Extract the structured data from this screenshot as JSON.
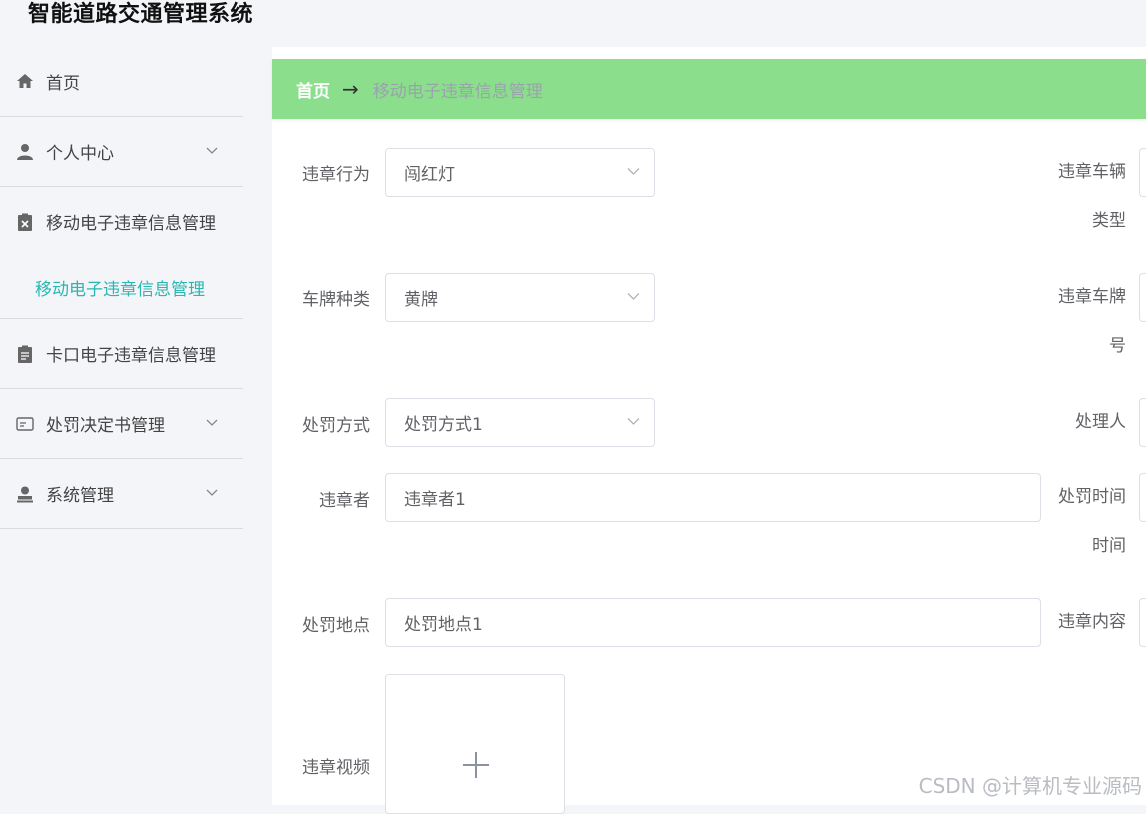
{
  "app": {
    "title": "智能道路交通管理系统"
  },
  "sidebar": {
    "items": [
      {
        "label": "首页",
        "icon": "home-icon"
      },
      {
        "label": "个人中心",
        "icon": "user-icon"
      },
      {
        "label": "移动电子违章信息管理",
        "icon": "clipboard-x-icon",
        "sub": "移动电子违章信息管理"
      },
      {
        "label": "卡口电子违章信息管理",
        "icon": "clipboard-icon"
      },
      {
        "label": "处罚决定书管理",
        "icon": "id-card-icon"
      },
      {
        "label": "系统管理",
        "icon": "admin-icon"
      }
    ]
  },
  "breadcrumb": {
    "home": "首页",
    "separator": "→",
    "current": "移动电子违章信息管理"
  },
  "form": {
    "violation_behavior": {
      "label": "违章行为",
      "value": "闯红灯"
    },
    "vehicle_type": {
      "label_line1": "违章车辆",
      "label_line2": "类型"
    },
    "plate_type": {
      "label": "车牌种类",
      "value": "黄牌"
    },
    "plate_number": {
      "label_line1": "违章车牌",
      "label_line2": "号"
    },
    "penalty_method": {
      "label": "处罚方式",
      "value": "处罚方式1"
    },
    "handler": {
      "label": "处理人"
    },
    "violator": {
      "label": "违章者",
      "value": "违章者1"
    },
    "penalty_time": {
      "label_line1": "处罚时间",
      "label_line2": "时间"
    },
    "penalty_location": {
      "label": "处罚地点",
      "value": "处罚地点1"
    },
    "violation_content": {
      "label": "违章内容"
    },
    "violation_video": {
      "label": "违章视频"
    }
  },
  "watermark": "CSDN @计算机专业源码",
  "colors": {
    "breadcrumb_bg": "#8ade8c",
    "active_submenu": "#2ab7b0",
    "page_bg": "#f3f5f8"
  }
}
